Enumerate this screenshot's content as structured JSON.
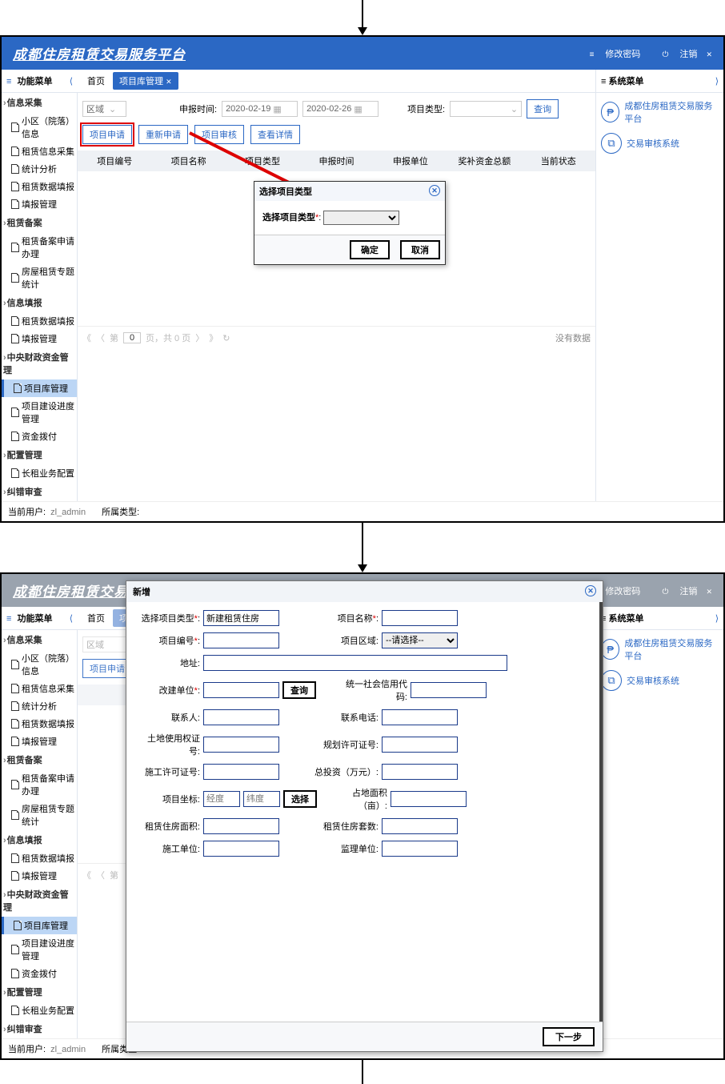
{
  "app_title": "成都住房租赁交易服务平台",
  "header_actions": {
    "change_pwd": "修改密码",
    "logout": "注销"
  },
  "menu_title": "功能菜单",
  "sysmenu_title": "系统菜单",
  "tabs": {
    "home": "首页",
    "active": "项目库管理"
  },
  "sidebar": {
    "g1": "信息采集",
    "g1_items": [
      "小区（院落）信息",
      "租赁信息采集",
      "统计分析",
      "租赁数据填报",
      "填报管理"
    ],
    "g2": "租赁备案",
    "g2_items": [
      "租赁备案申请办理",
      "房屋租赁专题统计"
    ],
    "g3": "信息填报",
    "g3_items": [
      "租赁数据填报",
      "填报管理"
    ],
    "g4": "中央财政资金管理",
    "g4_items": [
      "项目库管理",
      "项目建设进度管理",
      "资金拨付"
    ],
    "g5": "配置管理",
    "g5_items": [
      "长租业务配置"
    ],
    "g6": "纠错审查"
  },
  "filters": {
    "region_label": "区域",
    "time_label": "申报时间:",
    "date_from": "2020-02-19",
    "date_to": "2020-02-26",
    "type_label": "项目类型:",
    "query": "查询"
  },
  "btns": {
    "apply": "项目申请",
    "reapply": "重新申请",
    "audit": "项目审核",
    "detail": "查看详情"
  },
  "thead": [
    "项目编号",
    "项目名称",
    "项目类型",
    "申报时间",
    "申报单位",
    "奖补资金总额",
    "当前状态"
  ],
  "pager": {
    "page": "0",
    "text_prefix": "第",
    "text_mid": "页，共 0 页",
    "nodata": "没有数据"
  },
  "rightpane": {
    "item1": "成都住房租赁交易服务平台",
    "item2": "交易审核系统"
  },
  "footer": {
    "user_label": "当前用户:",
    "user": "zl_admin",
    "type_label": "所属类型:"
  },
  "dlg1": {
    "title": "选择项目类型",
    "field": "选择项目类型",
    "ok": "确定",
    "cancel": "取消"
  },
  "dlg2": {
    "title": "新增",
    "f_type": "选择项目类型",
    "f_type_val": "新建租赁住房",
    "f_name": "项目名称",
    "f_code": "项目编号",
    "f_region": "项目区域:",
    "f_region_val": "--请选择--",
    "f_addr": "地址:",
    "f_dev": "改建单位",
    "f_query": "查询",
    "f_credit": "统一社会信用代码:",
    "f_contact": "联系人:",
    "f_phone": "联系电话:",
    "f_land": "土地使用权证号:",
    "f_plan": "规划许可证号:",
    "f_build": "施工许可证号:",
    "f_invest": "总投资（万元）:",
    "f_coord": "项目坐标:",
    "f_lng": "经度",
    "f_lat": "纬度",
    "f_pick": "选择",
    "f_area": "占地面积（亩）:",
    "f_rent_area": "租赁住房面积:",
    "f_rent_units": "租赁住房套数:",
    "f_builder": "施工单位:",
    "f_super": "监理单位:",
    "next": "下一步"
  }
}
